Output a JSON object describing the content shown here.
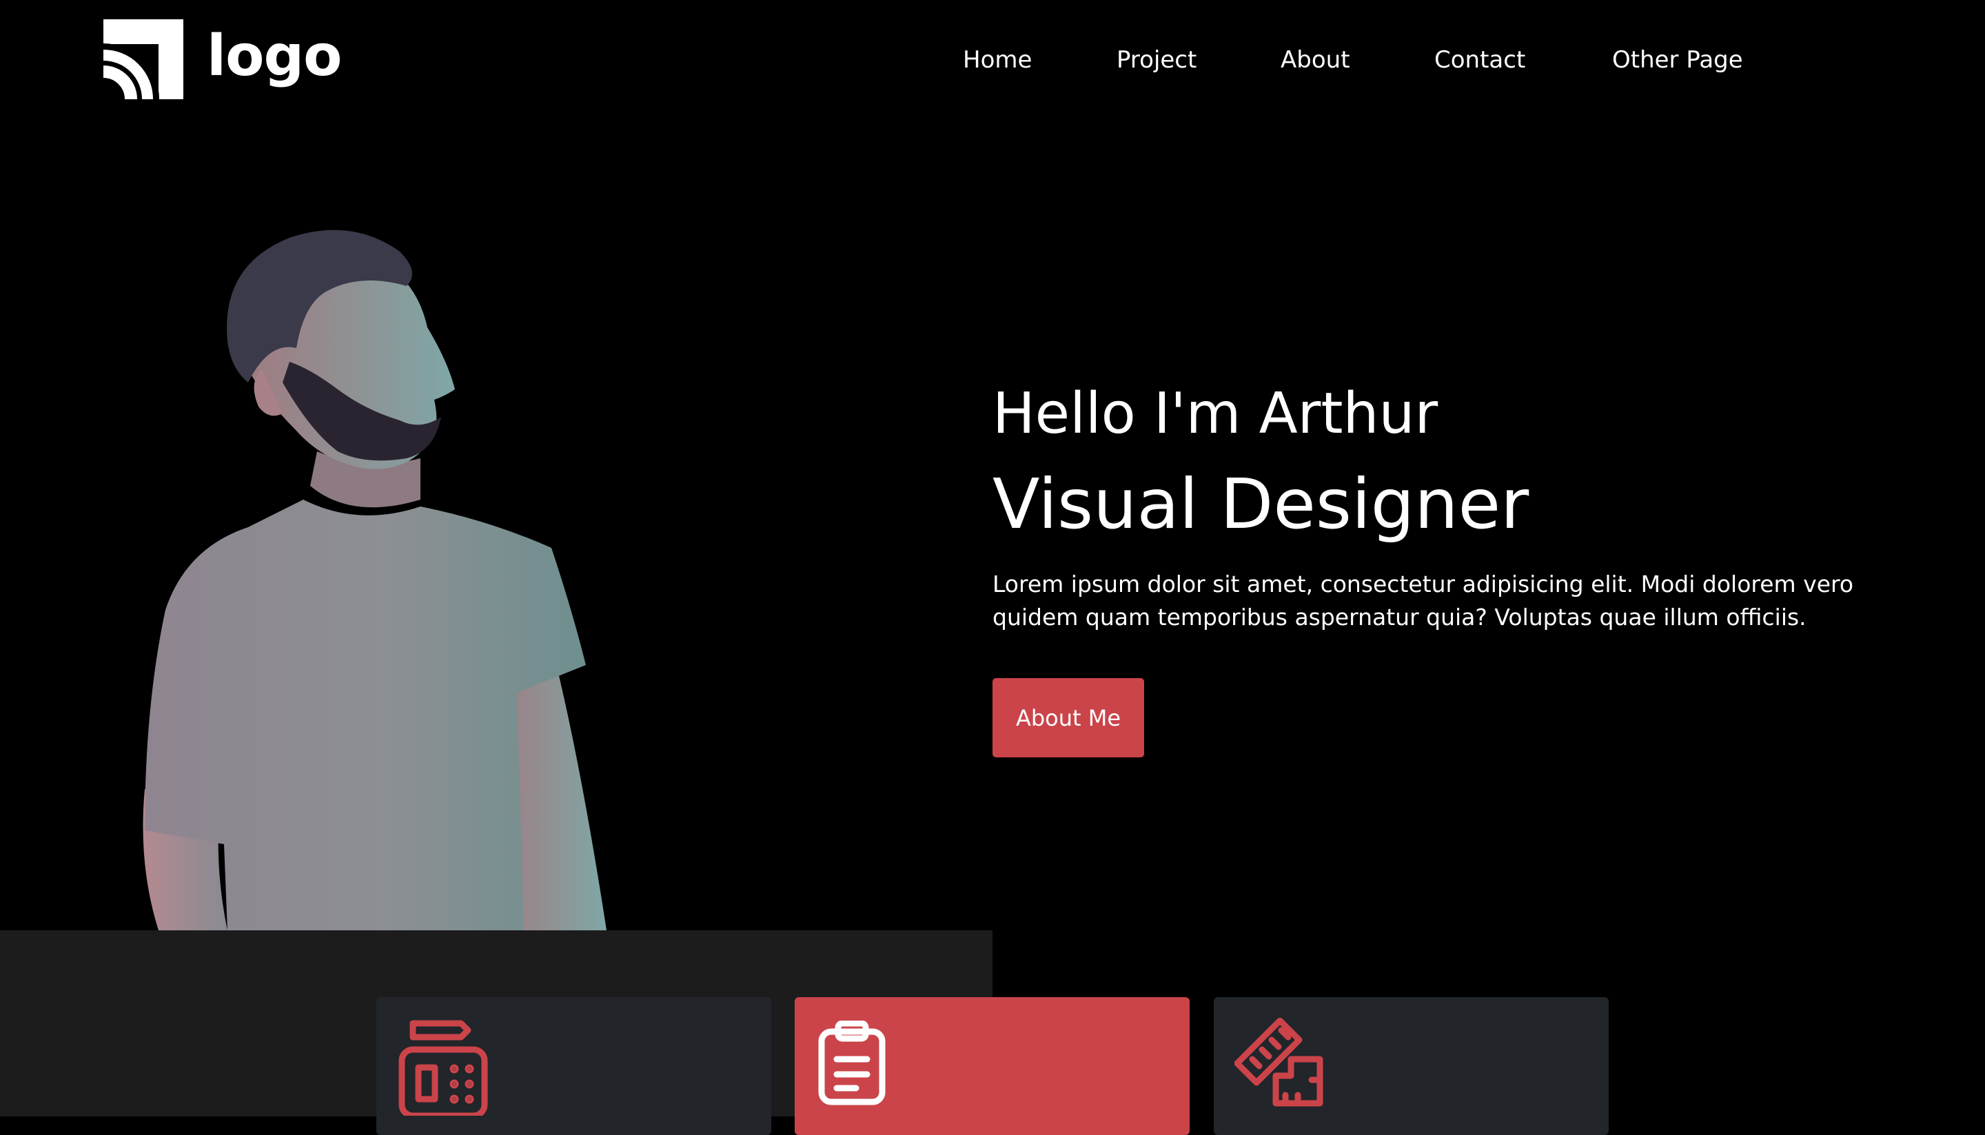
{
  "header": {
    "logo_text": "logo",
    "nav": [
      "Home",
      "Project",
      "About",
      "Contact",
      "Other Page"
    ]
  },
  "hero": {
    "greeting": "Hello I'm Arthur",
    "role": "Visual Designer",
    "intro": "Lorem ipsum dolor sit amet, consectetur adipisicing elit. Modi dolorem vero quidem quam temporibus aspernatur quia? Voluptas quae illum officiis.",
    "cta_label": "About Me",
    "photo": "bearded-man-grey-tshirt-portrait"
  },
  "services": {
    "cards": [
      {
        "icon": "fax-machine-icon",
        "active": false
      },
      {
        "icon": "clipboard-icon",
        "active": true
      },
      {
        "icon": "ruler-square-icon",
        "active": false
      }
    ]
  },
  "colors": {
    "accent": "#cb444a",
    "background": "#000000",
    "card": "#22252a",
    "band": "#1c1c1c"
  }
}
